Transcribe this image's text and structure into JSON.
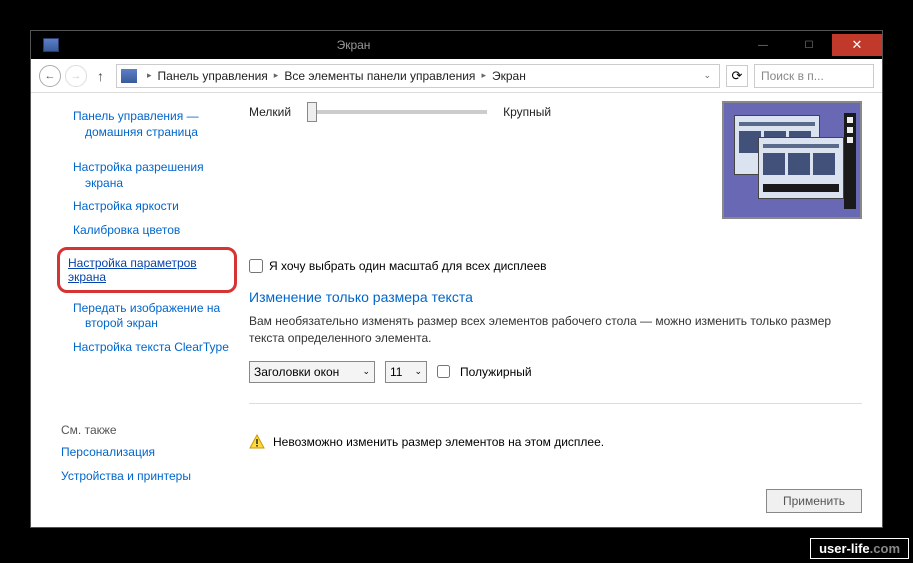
{
  "titlebar": {
    "title": "Экран"
  },
  "win_controls": {
    "min": "—",
    "max": "☐",
    "close": "✕"
  },
  "nav": {
    "back": "←",
    "forward": "→",
    "up": "↑",
    "refresh": "⟳"
  },
  "breadcrumb": {
    "parts": [
      "Панель управления",
      "Все элементы панели управления",
      "Экран"
    ],
    "sep": "▸",
    "dropdown": "⌄"
  },
  "search": {
    "placeholder": "Поиск в п..."
  },
  "sidebar": {
    "links": {
      "home": "Панель управления — домашняя страница",
      "resolution": "Настройка разрешения экрана",
      "brightness": "Настройка яркости",
      "calibration": "Калибровка цветов",
      "params": "Настройка параметров экрана",
      "cast": "Передать изображение на второй экран",
      "cleartype": "Настройка текста ClearType"
    },
    "see_also_label": "См. также",
    "see_also": {
      "personalization": "Персонализация",
      "devices": "Устройства и принтеры"
    }
  },
  "main": {
    "slider_small": "Мелкий",
    "slider_large": "Крупный",
    "checkbox_label": "Я хочу выбрать один масштаб для всех дисплеев",
    "section_title": "Изменение только размера текста",
    "section_desc": "Вам необязательно изменять размер всех элементов рабочего стола — можно изменить только размер текста определенного элемента.",
    "select_element": "Заголовки окон",
    "select_size": "11",
    "bold_label": "Полужирный",
    "warning": "Невозможно изменить размер элементов на этом дисплее.",
    "apply": "Применить"
  },
  "watermark": {
    "prefix": "user-life",
    "suffix": ".com"
  }
}
